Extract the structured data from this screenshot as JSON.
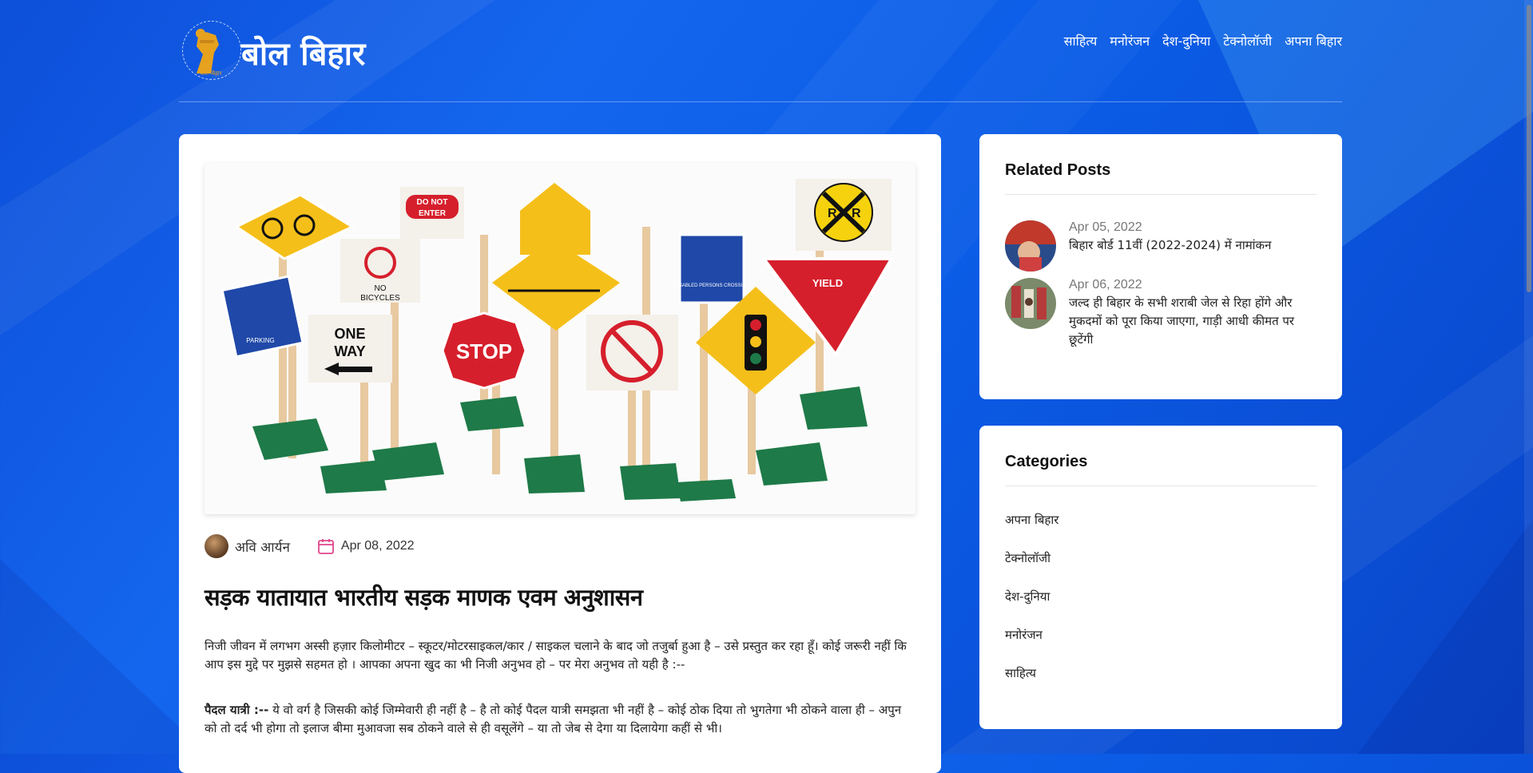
{
  "site": {
    "brand": "बोल बिहार",
    "logo_caption": "बोल बिहार"
  },
  "nav": {
    "items": [
      {
        "label": "साहित्य"
      },
      {
        "label": "मनोरंजन"
      },
      {
        "label": "देश-दुनिया"
      },
      {
        "label": "टेक्नोलॉजी"
      },
      {
        "label": "अपना बिहार"
      }
    ]
  },
  "post": {
    "author": "अवि आर्यन",
    "date": "Apr 08, 2022",
    "title": "सड़क यातायात भारतीय सड़क माणक एवम अनुशासन",
    "para1": "निजी जीवन में लगभग अस्सी हज़ार किलोमीटर – स्कूटर/मोटरसाइकल/कार / साइकल चलाने के बाद जो तजुर्बा हुआ है – उसे प्रस्तुत कर रहा हूँ। कोई जरूरी नहीं कि आप इस मुद्दे पर मुझसे सहमत हो । आपका अपना खुद का भी निजी अनुभव हो – पर मेरा अनुभव तो यही है :--",
    "para2_bold": "पैदल यात्री :--",
    "para2_rest": " ये वो वर्ग है जिसकी कोई जिम्मेवारी ही नहीं है – है तो कोई पैदल यात्री समझता भी नहीं है – कोई ठोक दिया तो भुगतेगा भी ठोकने वाला ही – अपुन को तो दर्द भी होगा तो इलाज बीमा मुआवजा सब ठोकने वाले से ही वसूलेंगे – या तो जेब से देगा या दिलायेगा कहीं से भी।",
    "sign_texts": {
      "do_not_enter_1": "DO NOT",
      "do_not_enter_2": "ENTER",
      "no_bicycles_1": "NO",
      "no_bicycles_2": "BICYCLES",
      "one_way_1": "ONE",
      "one_way_2": "WAY",
      "stop": "STOP",
      "yield": "YIELD",
      "parking": "PARKING",
      "disabled": "DISABLED PERSONS CROSSING",
      "rxr_r1": "R",
      "rxr_r2": "R"
    }
  },
  "sidebar": {
    "related_title": "Related Posts",
    "related": [
      {
        "date": "Apr 05, 2022",
        "title": "बिहार बोर्ड 11वीं (2022-2024) में नामांकन"
      },
      {
        "date": "Apr 06, 2022",
        "title": "जल्द ही बिहार के सभी शराबी जेल से रिहा होंगे और मुकदमों को पूरा किया जाएगा, गाड़ी आधी कीमत पर छूटेंगी"
      }
    ],
    "categories_title": "Categories",
    "categories": [
      {
        "label": "अपना बिहार"
      },
      {
        "label": "टेक्नोलॉजी"
      },
      {
        "label": "देश-दुनिया"
      },
      {
        "label": "मनोरंजन"
      },
      {
        "label": "साहित्य"
      }
    ]
  },
  "colors": {
    "background": "#1566ee",
    "accent_calendar": "#e0468a",
    "logo_gold": "#e6a21e"
  }
}
